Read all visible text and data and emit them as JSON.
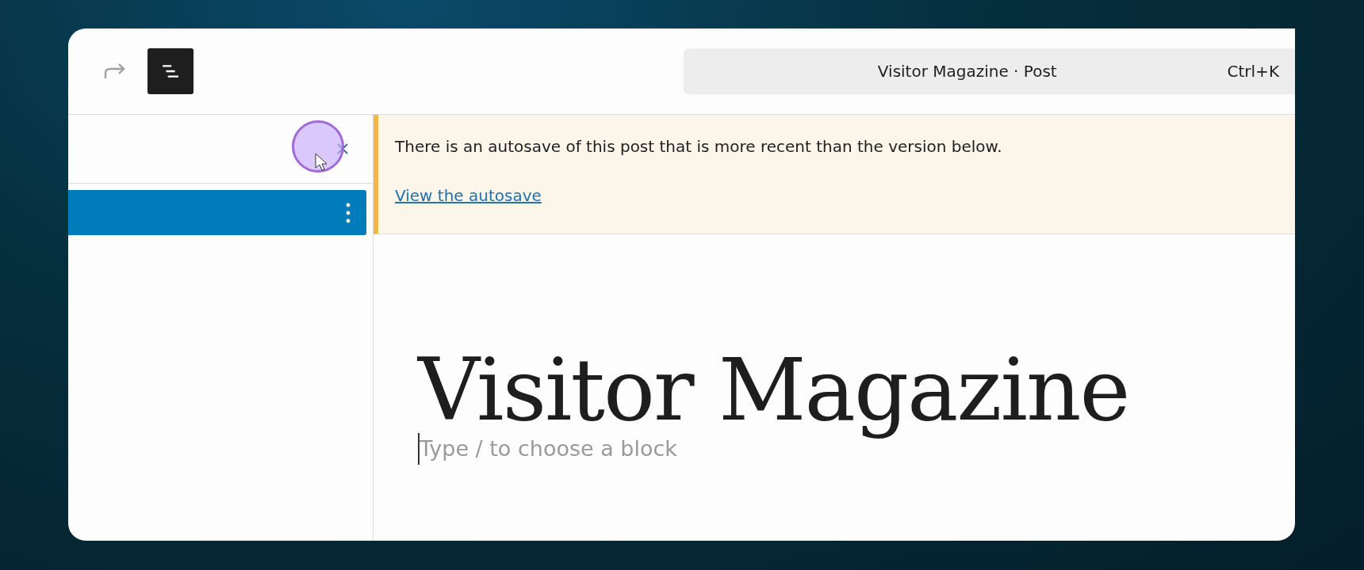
{
  "toolbar": {
    "list_view_toggle": {
      "pressed": true
    },
    "command_bar": {
      "title": "Visitor Magazine · Post",
      "shortcut": "Ctrl+K"
    }
  },
  "sidebar": {
    "items": [
      {
        "selected": true
      }
    ]
  },
  "notice": {
    "message": "There is an autosave of this post that is more recent than the version below.",
    "link": "View the autosave"
  },
  "editor": {
    "title": "Visitor Magazine",
    "placeholder": "Type / to choose a block"
  }
}
